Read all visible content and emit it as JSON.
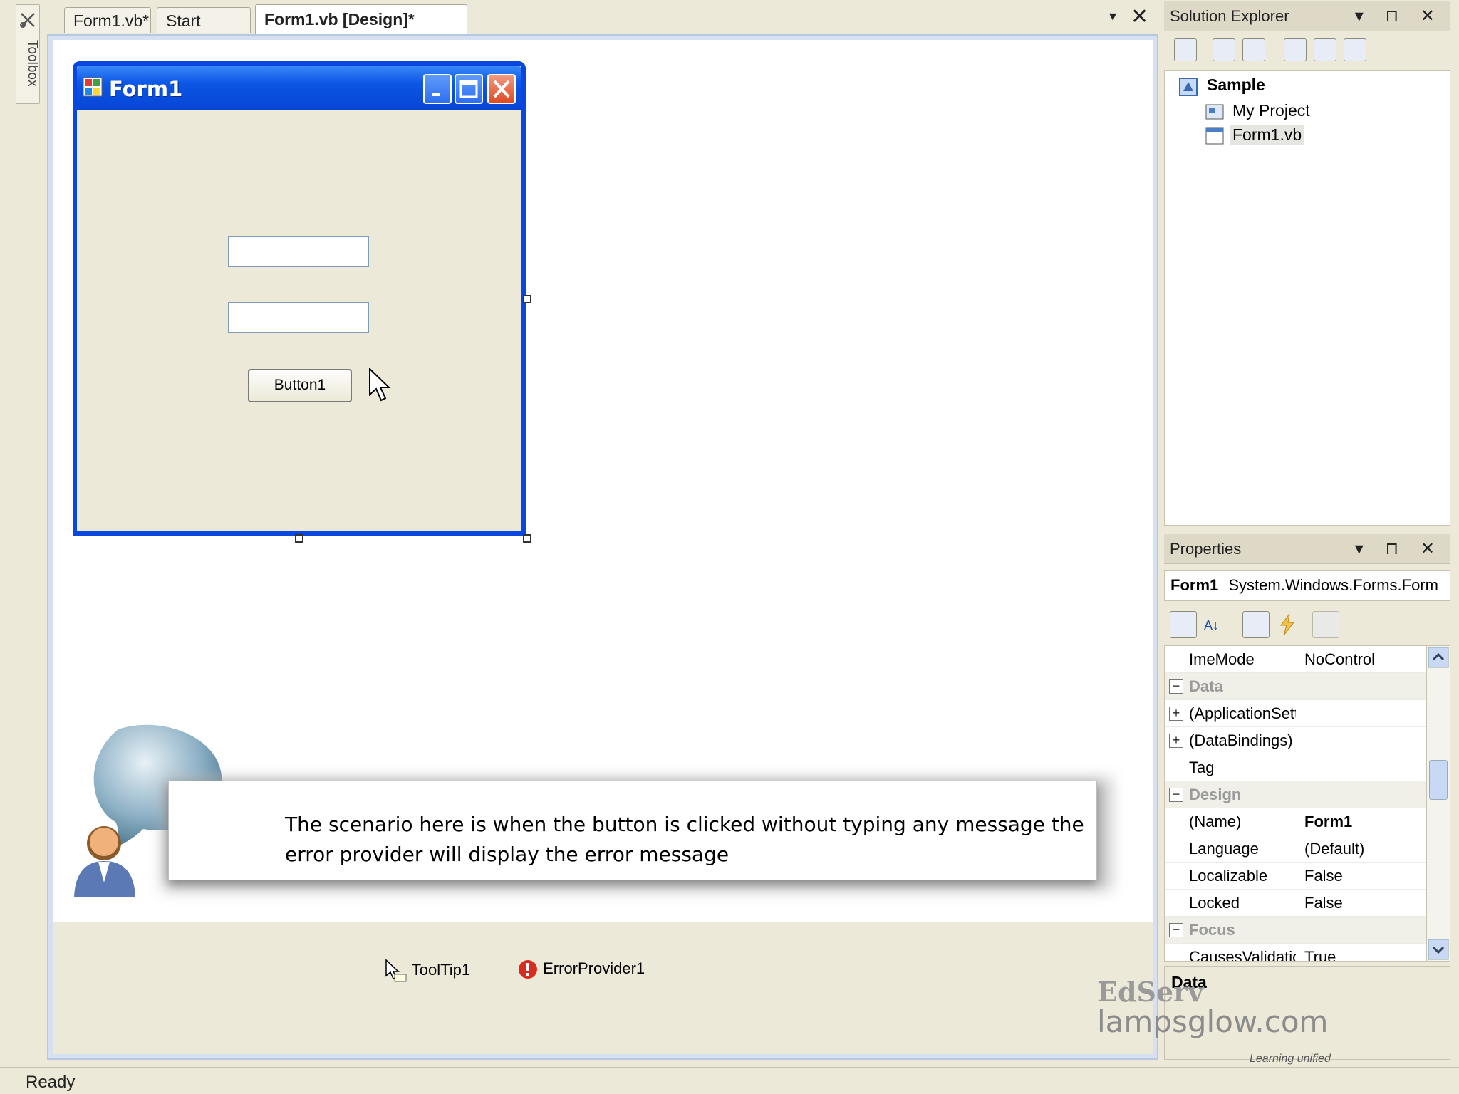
{
  "toolbox": {
    "label": "Toolbox"
  },
  "tabs": [
    {
      "label": "Form1.vb*"
    },
    {
      "label": "Start Page"
    },
    {
      "label": "Form1.vb [Design]*"
    }
  ],
  "tab_controls": {
    "dropdown": "▾",
    "close": "✕"
  },
  "form": {
    "title": "Form1",
    "button1_label": "Button1"
  },
  "callout": {
    "text": "The scenario here is when the button is clicked without typing any message the error provider will display the error message"
  },
  "tray": {
    "tooltip_label": "ToolTip1",
    "errorprovider_label": "ErrorProvider1"
  },
  "solution_explorer": {
    "title": "Solution Explorer",
    "buttons": "▾ ⊓ ✕",
    "tree": [
      {
        "label": "Sample"
      },
      {
        "label": "My Project"
      },
      {
        "label": "Form1.vb"
      }
    ]
  },
  "properties": {
    "title": "Properties",
    "buttons": "▾ ⊓ ✕",
    "object_name": "Form1",
    "object_type": "System.Windows.Forms.Form",
    "rows": [
      {
        "name": "ImeMode",
        "value": "NoControl",
        "kind": "prop"
      },
      {
        "name": "Data",
        "value": "",
        "kind": "cat"
      },
      {
        "name": "(ApplicationSetti",
        "value": "",
        "kind": "expand"
      },
      {
        "name": "(DataBindings)",
        "value": "",
        "kind": "expand"
      },
      {
        "name": "Tag",
        "value": "",
        "kind": "prop"
      },
      {
        "name": "Design",
        "value": "",
        "kind": "cat"
      },
      {
        "name": "(Name)",
        "value": "Form1",
        "kind": "prop-bold"
      },
      {
        "name": "Language",
        "value": "(Default)",
        "kind": "prop"
      },
      {
        "name": "Localizable",
        "value": "False",
        "kind": "prop"
      },
      {
        "name": "Locked",
        "value": "False",
        "kind": "prop"
      },
      {
        "name": "Focus",
        "value": "",
        "kind": "cat"
      },
      {
        "name": "CausesValidation",
        "value": "True",
        "kind": "prop"
      }
    ],
    "description_title": "Data"
  },
  "watermark": {
    "line1": "EdServ",
    "line2": "lampsglow.com",
    "line3": "Learning unified"
  },
  "status": {
    "text": "Ready"
  },
  "colors": {
    "form_border": "#0a46e0",
    "titlebar": "#0c56e6",
    "design_bg": "#ffffff",
    "ide_bg": "#ece9d8"
  }
}
